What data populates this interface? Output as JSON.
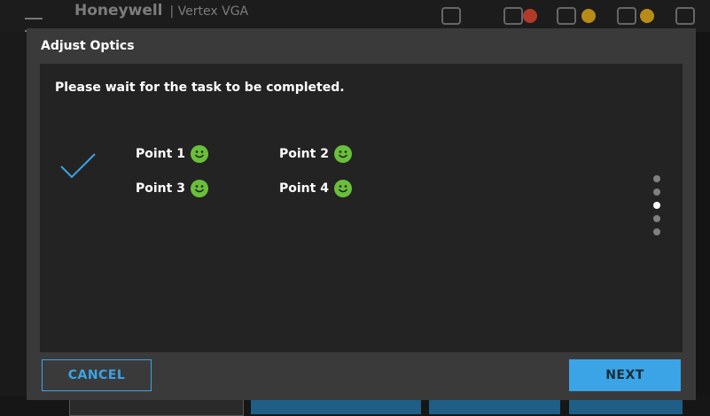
{
  "background": {
    "brand": "Honeywell",
    "product": "| Vertex VGA"
  },
  "dialog": {
    "title": "Adjust Optics",
    "message": "Please wait for the task to be completed.",
    "status_icon": "checkmark-icon",
    "points": [
      {
        "label": "Point 1",
        "status_icon": "smiley-icon",
        "status_color": "#6abf3a"
      },
      {
        "label": "Point 2",
        "status_icon": "smiley-icon",
        "status_color": "#6abf3a"
      },
      {
        "label": "Point 3",
        "status_icon": "smiley-icon",
        "status_color": "#6abf3a"
      },
      {
        "label": "Point 4",
        "status_icon": "smiley-icon",
        "status_color": "#6abf3a"
      }
    ],
    "step_indicator": {
      "total": 5,
      "current": 3
    },
    "cancel_label": "CANCEL",
    "next_label": "NEXT"
  },
  "colors": {
    "accent": "#3aa4e6",
    "success": "#6abf3a"
  }
}
